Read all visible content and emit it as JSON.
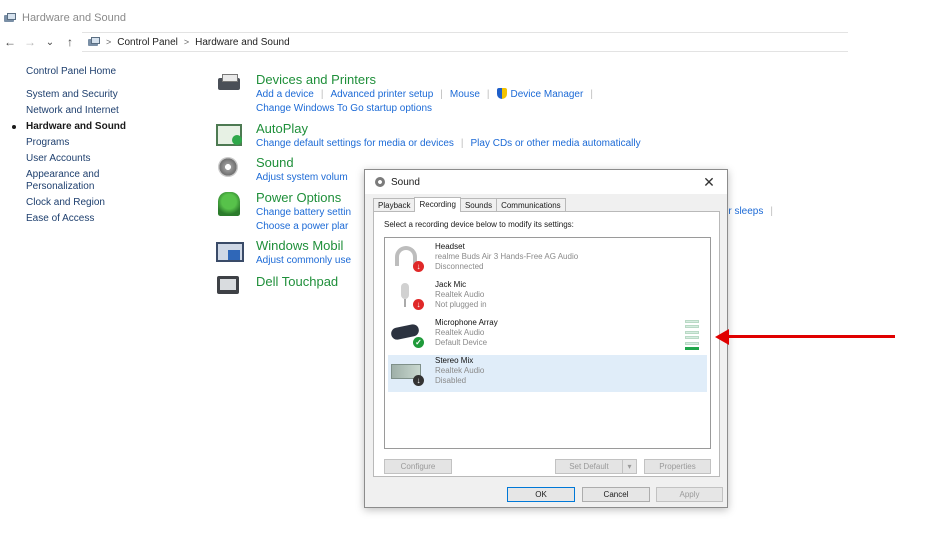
{
  "window": {
    "title": "Hardware and Sound"
  },
  "address": {
    "crumbs": [
      "Control Panel",
      "Hardware and Sound"
    ],
    "separator": ">"
  },
  "nav": {
    "back": "←",
    "forward": "→",
    "recent": "⌄",
    "up": "↑"
  },
  "leftnav": {
    "home": "Control Panel Home",
    "items": [
      {
        "label": "System and Security"
      },
      {
        "label": "Network and Internet"
      },
      {
        "label": "Hardware and Sound"
      },
      {
        "label": "Programs"
      },
      {
        "label": "User Accounts"
      },
      {
        "label": "Appearance and Personalization"
      },
      {
        "label": "Clock and Region"
      },
      {
        "label": "Ease of Access"
      }
    ]
  },
  "categories": {
    "devices": {
      "title": "Devices and Printers",
      "links": [
        "Add a device",
        "Advanced printer setup",
        "Mouse",
        "Device Manager"
      ],
      "links2": [
        "Change Windows To Go startup options"
      ]
    },
    "autoplay": {
      "title": "AutoPlay",
      "links": [
        "Change default settings for media or devices",
        "Play CDs or other media automatically"
      ]
    },
    "sound": {
      "title": "Sound",
      "links": [
        "Adjust system volum"
      ]
    },
    "power": {
      "title": "Power Options",
      "links": [
        "Change battery settin"
      ],
      "links2": [
        "Choose a power plar"
      ],
      "clipped": "ter sleeps"
    },
    "mobility": {
      "title": "Windows Mobil",
      "links": [
        "Adjust commonly use"
      ]
    },
    "touchpad": {
      "title": "Dell Touchpad"
    }
  },
  "dialog": {
    "title": "Sound",
    "close": "✕",
    "tabs": [
      "Playback",
      "Recording",
      "Sounds",
      "Communications"
    ],
    "instruction": "Select a recording device below to modify its settings:",
    "devices": [
      {
        "name": "Headset",
        "detail": "realme Buds Air 3 Hands-Free AG Audio",
        "status": "Disconnected",
        "badge": "↓"
      },
      {
        "name": "Jack Mic",
        "detail": "Realtek Audio",
        "status": "Not plugged in",
        "badge": "↓"
      },
      {
        "name": "Microphone Array",
        "detail": "Realtek Audio",
        "status": "Default Device",
        "badge": "✓",
        "level": 0.2
      },
      {
        "name": "Stereo Mix",
        "detail": "Realtek Audio",
        "status": "Disabled",
        "badge": "↓"
      }
    ],
    "buttons": {
      "configure": "Configure",
      "set_default": "Set Default",
      "dropdown": "▾",
      "properties": "Properties",
      "ok": "OK",
      "cancel": "Cancel",
      "apply": "Apply"
    }
  },
  "colors": {
    "category_title": "#1f8f3a",
    "link": "#1c6ad6",
    "arrow": "#e00000",
    "selection": "#e0edf9"
  }
}
